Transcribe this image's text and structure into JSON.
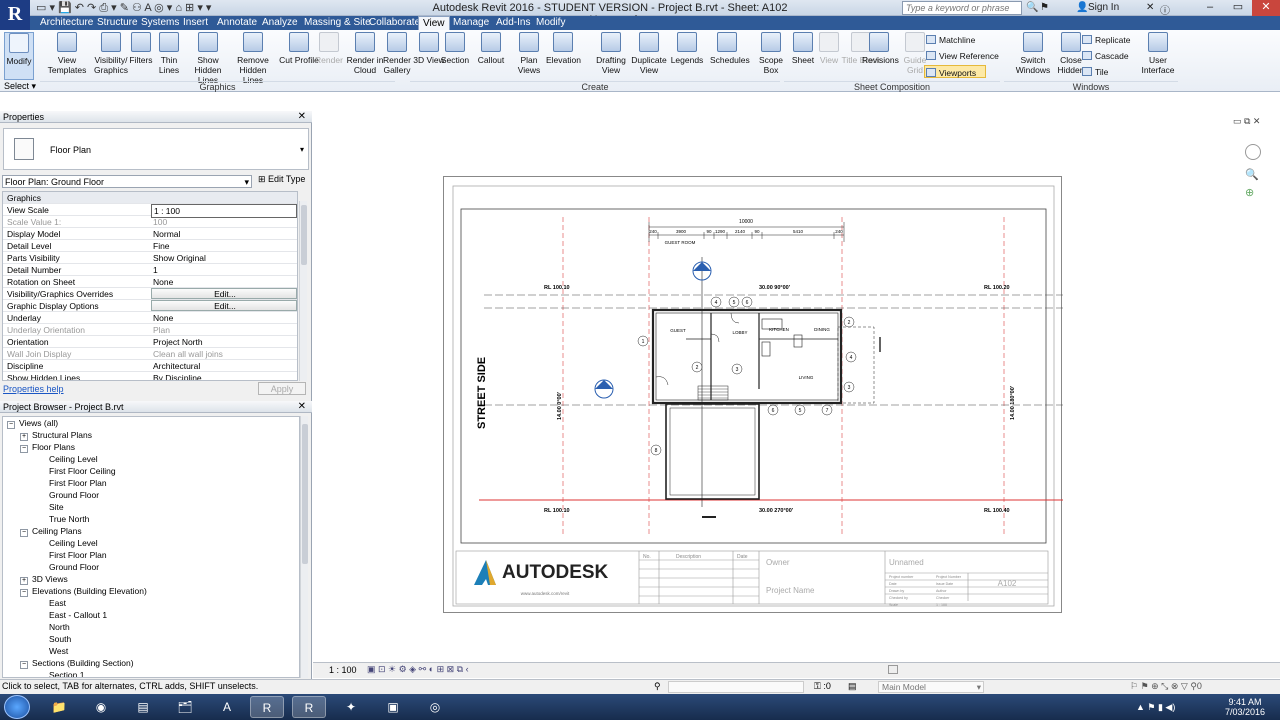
{
  "app": {
    "title": "Autodesk Revit 2016 - STUDENT VERSION -    Project B.rvt - Sheet: A102 - Unnamed",
    "search_placeholder": "Type a keyword or phrase",
    "sign_in": "Sign In",
    "logo": "R"
  },
  "tabs": [
    "Architecture",
    "Structure",
    "Systems",
    "Insert",
    "Annotate",
    "Analyze",
    "Massing & Site",
    "Collaborate",
    "View",
    "Manage",
    "Add-Ins",
    "Modify"
  ],
  "active_tab": "View",
  "ribbon": {
    "modify": "Modify",
    "select": "Select",
    "graphics": [
      "View Templates",
      "Visibility/ Graphics",
      "Filters",
      "Thin Lines",
      "Show Hidden Lines",
      "Remove Hidden Lines",
      "Cut Profile"
    ],
    "presentation": [
      "Render",
      "Render in Cloud",
      "Render Gallery"
    ],
    "create": [
      "3D View",
      "Section",
      "Callout",
      "Plan Views",
      "Elevation",
      "Drafting View",
      "Duplicate View",
      "Legends",
      "Schedules",
      "Scope Box"
    ],
    "sheet": [
      "Sheet",
      "View",
      "Title Block",
      "Revisions",
      "Guide Grid"
    ],
    "sheet_small": [
      "Matchline",
      "View Reference",
      "Viewports"
    ],
    "windows": [
      "Switch Windows",
      "Close Hidden"
    ],
    "windows_small": [
      "Replicate",
      "Cascade",
      "Tile"
    ],
    "user_interface": "User Interface",
    "panels": [
      "Graphics",
      "Create",
      "Sheet Composition",
      "Windows"
    ]
  },
  "properties": {
    "header": "Properties",
    "type": "Floor Plan",
    "view_dropdown": "Floor Plan: Ground Floor",
    "edit_type": "Edit Type",
    "group": "Graphics",
    "rows": [
      {
        "k": "View Scale",
        "v": "1 : 100"
      },
      {
        "k": "Scale Value    1:",
        "v": "100"
      },
      {
        "k": "Display Model",
        "v": "Normal"
      },
      {
        "k": "Detail Level",
        "v": "Fine"
      },
      {
        "k": "Parts Visibility",
        "v": "Show Original"
      },
      {
        "k": "Detail Number",
        "v": "1"
      },
      {
        "k": "Rotation on Sheet",
        "v": "None"
      },
      {
        "k": "Visibility/Graphics Overrides",
        "v": "Edit..."
      },
      {
        "k": "Graphic Display Options",
        "v": "Edit..."
      },
      {
        "k": "Underlay",
        "v": "None"
      },
      {
        "k": "Underlay Orientation",
        "v": "Plan"
      },
      {
        "k": "Orientation",
        "v": "Project North"
      },
      {
        "k": "Wall Join Display",
        "v": "Clean all wall joins"
      },
      {
        "k": "Discipline",
        "v": "Architectural"
      },
      {
        "k": "Show Hidden Lines",
        "v": "By Discipline"
      }
    ],
    "help": "Properties help",
    "apply": "Apply"
  },
  "browser": {
    "header": "Project Browser - Project B.rvt",
    "items": [
      {
        "t": "Views (all)",
        "lvl": 0,
        "tog": "−"
      },
      {
        "t": "Structural Plans",
        "lvl": 1,
        "tog": "+"
      },
      {
        "t": "Floor Plans",
        "lvl": 1,
        "tog": "−"
      },
      {
        "t": "Ceiling Level",
        "lvl": 2
      },
      {
        "t": "First Floor Ceiling",
        "lvl": 2
      },
      {
        "t": "First Floor Plan",
        "lvl": 2
      },
      {
        "t": "Ground Floor",
        "lvl": 2
      },
      {
        "t": "Site",
        "lvl": 2
      },
      {
        "t": "True North",
        "lvl": 2
      },
      {
        "t": "Ceiling Plans",
        "lvl": 1,
        "tog": "−"
      },
      {
        "t": "Ceiling Level",
        "lvl": 2
      },
      {
        "t": "First Floor Plan",
        "lvl": 2
      },
      {
        "t": "Ground Floor",
        "lvl": 2
      },
      {
        "t": "3D Views",
        "lvl": 1,
        "tog": "+"
      },
      {
        "t": "Elevations (Building Elevation)",
        "lvl": 1,
        "tog": "−"
      },
      {
        "t": "East",
        "lvl": 2
      },
      {
        "t": "East - Callout 1",
        "lvl": 2
      },
      {
        "t": "North",
        "lvl": 2
      },
      {
        "t": "South",
        "lvl": 2
      },
      {
        "t": "West",
        "lvl": 2
      },
      {
        "t": "Sections (Building Section)",
        "lvl": 1,
        "tog": "−"
      },
      {
        "t": "Section 1",
        "lvl": 2
      }
    ]
  },
  "drawing": {
    "street": "STREET SIDE",
    "dim_top": "10000",
    "dims_row": [
      "240",
      "3900",
      "90",
      "1290",
      "2140",
      "90",
      "5410",
      "240"
    ],
    "guest_room": "GUEST ROOM",
    "rooms": [
      "GUEST",
      "LOBBY",
      "KITCHEN",
      "DINING",
      "LIVING"
    ],
    "bearing_top": "30.00  90°00'",
    "bearing_bot": "30.00  270°00'",
    "bearing_left": "14.00  0°00'",
    "bearing_right": "14.00  180°00'",
    "rl": [
      "RL 100.10",
      "RL 100.20",
      "RL 100.10",
      "RL 100.40"
    ],
    "tags": [
      "1",
      "2",
      "3",
      "4",
      "5",
      "6",
      "7",
      "8",
      "9",
      "10",
      "11",
      "12"
    ],
    "title_block": {
      "brand": "AUTODESK",
      "url": "www.autodesk.com/revit",
      "no": "No.",
      "description": "Description",
      "date": "Date",
      "owner": "Owner",
      "project_name": "Project Name",
      "unnamed": "Unnamed",
      "sheet_no": "A102",
      "fields": [
        "Project number",
        "Project Number",
        "Date",
        "Issue Date",
        "Drawn by",
        "Author",
        "Checked by",
        "Checker",
        "Scale",
        "1 : 100"
      ]
    }
  },
  "status": {
    "scale": "1 : 100",
    "message": "Click to select, TAB for alternates, CTRL adds, SHIFT unselects.",
    "zero": ":0",
    "model": "Main Model"
  },
  "clock": {
    "time": "9:41 AM",
    "date": "7/03/2016"
  }
}
